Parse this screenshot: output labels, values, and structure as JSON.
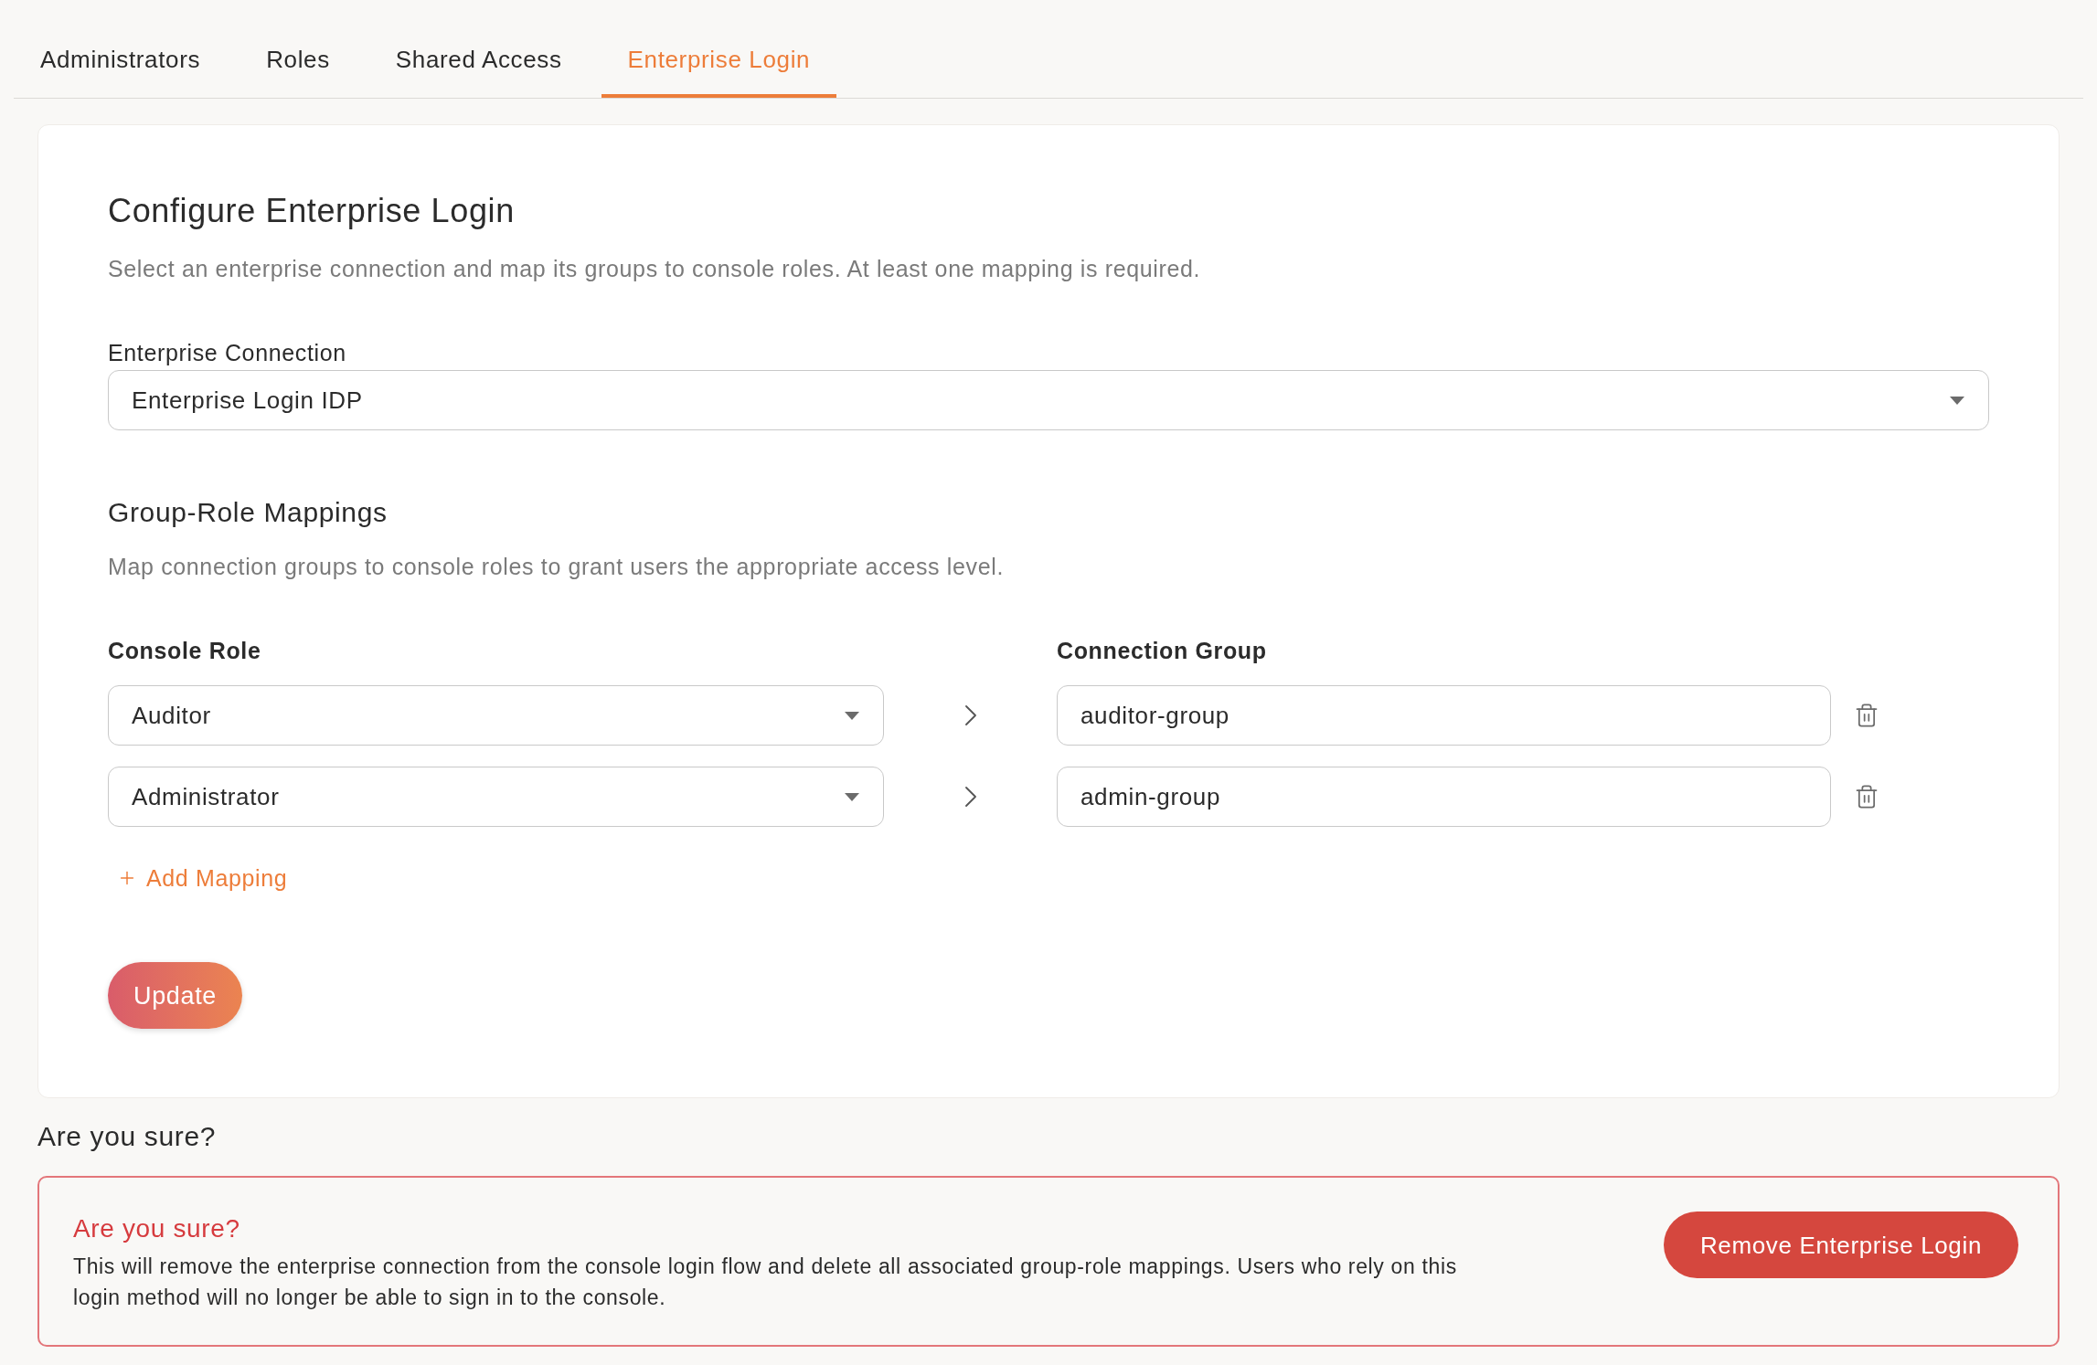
{
  "tabs": [
    {
      "label": "Administrators",
      "selected": false
    },
    {
      "label": "Roles",
      "selected": false
    },
    {
      "label": "Shared Access",
      "selected": false
    },
    {
      "label": "Enterprise Login",
      "selected": true
    }
  ],
  "configure": {
    "title": "Configure Enterprise Login",
    "description": "Select an enterprise connection and map its groups to console roles. At least one mapping is required.",
    "connection": {
      "label": "Enterprise Connection",
      "value": "Enterprise Login IDP"
    }
  },
  "mappings": {
    "title": "Group-Role Mappings",
    "description": "Map connection groups to console roles to grant users the appropriate access level.",
    "columns": [
      "Console Role",
      "Connection Group"
    ],
    "rows": [
      {
        "role": "Auditor",
        "group": "auditor-group"
      },
      {
        "role": "Administrator",
        "group": "admin-group"
      }
    ],
    "add_label": "Add Mapping"
  },
  "update_button": "Update",
  "danger_zone": {
    "heading": "Are you sure?",
    "title": "Are you sure?",
    "text": "This will remove the enterprise connection from the console login flow and delete all associated group-role mappings. Users who rely on this login method will no longer be able to sign in to the console.",
    "button": "Remove Enterprise Login"
  }
}
